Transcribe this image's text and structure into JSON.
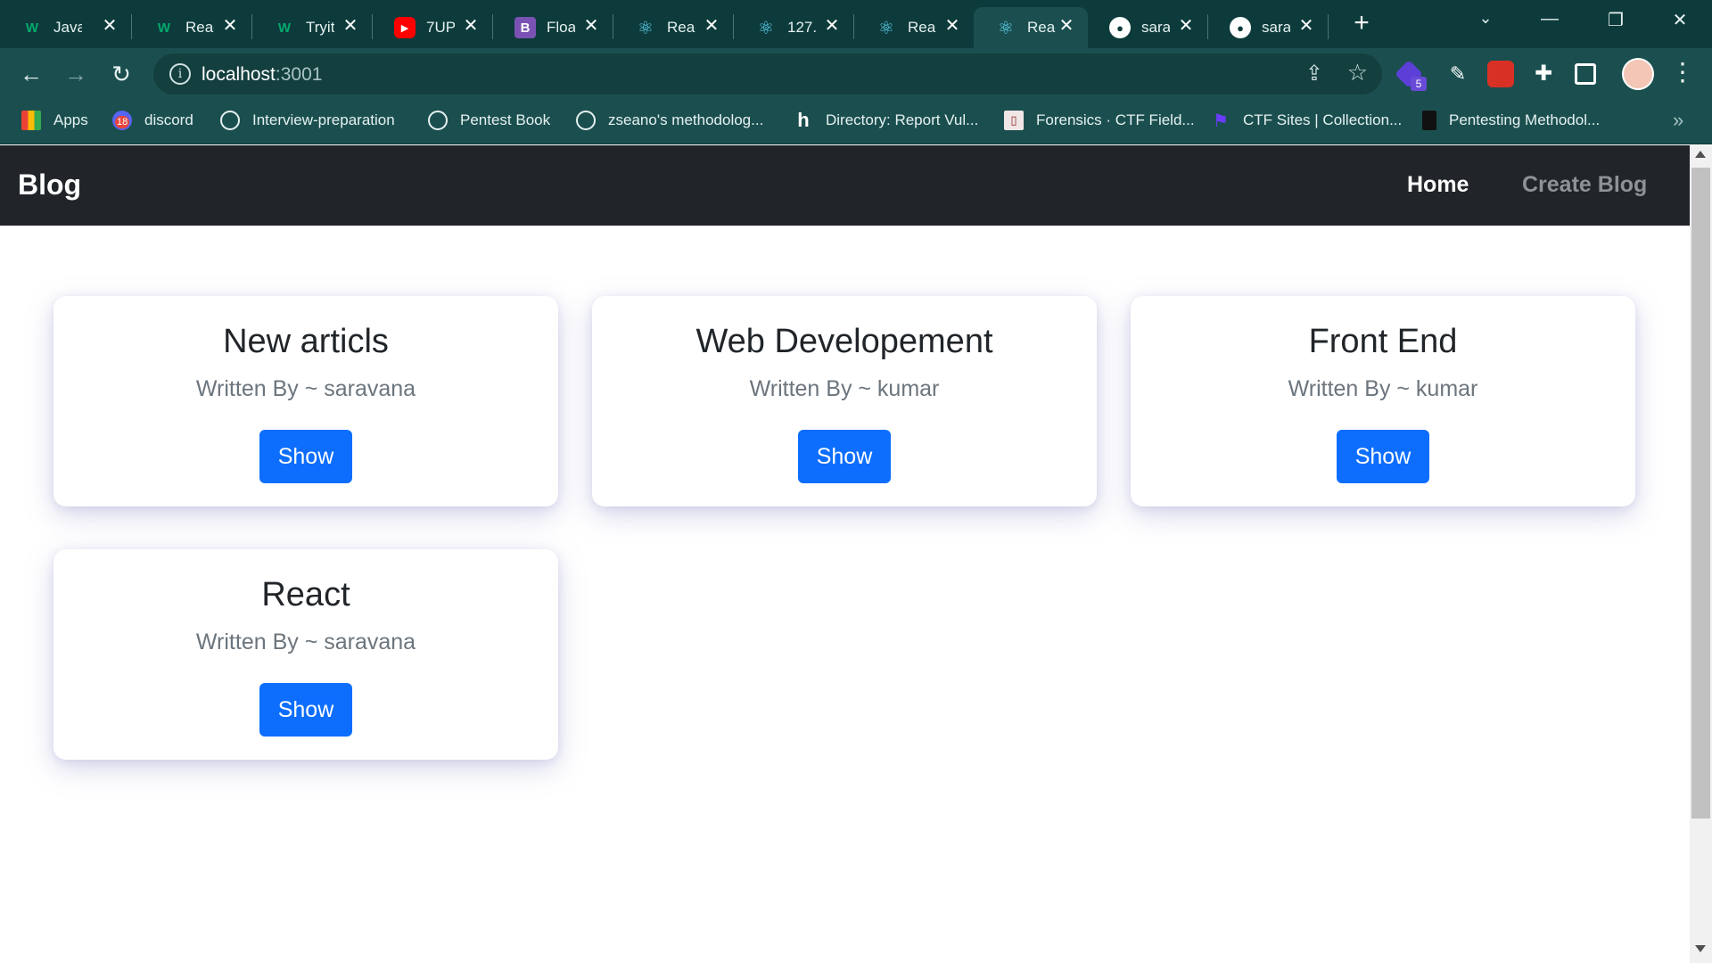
{
  "browser": {
    "tabs": [
      {
        "title": "Java",
        "icon": "w3schools-icon",
        "color": "#04aa6d"
      },
      {
        "title": "Reac",
        "icon": "w3schools-icon",
        "color": "#04aa6d"
      },
      {
        "title": "Tryit",
        "icon": "w3schools-icon",
        "color": "#04aa6d"
      },
      {
        "title": "7UP",
        "icon": "youtube-icon",
        "color": "#ff0000"
      },
      {
        "title": "Floa",
        "icon": "bootstrap-icon",
        "color": "#7952b3"
      },
      {
        "title": "Reac",
        "icon": "react-icon",
        "color": "#61dafb"
      },
      {
        "title": "127.",
        "icon": "react-icon",
        "color": "#61dafb"
      },
      {
        "title": "Reac",
        "icon": "react-icon",
        "color": "#61dafb"
      },
      {
        "title": "Reac",
        "icon": "react-icon",
        "color": "#61dafb",
        "active": true
      },
      {
        "title": "sara",
        "icon": "github-icon",
        "color": "#ffffff"
      },
      {
        "title": "sara",
        "icon": "github-icon",
        "color": "#ffffff"
      }
    ],
    "address": {
      "host": "localhost",
      "port": ":3001"
    },
    "bookmarks": [
      {
        "label": "Apps",
        "icon": "apps-grid-icon"
      },
      {
        "label": "discord",
        "icon": "discord-icon",
        "badge": "18"
      },
      {
        "label": "Interview-preparation",
        "icon": "globe-icon"
      },
      {
        "label": "Pentest Book",
        "icon": "globe-icon"
      },
      {
        "label": "zseano's methodolog...",
        "icon": "globe-icon"
      },
      {
        "label": "Directory: Report Vul...",
        "icon": "hackerone-icon"
      },
      {
        "label": "Forensics · CTF Field...",
        "icon": "book-icon"
      },
      {
        "label": "CTF Sites | Collection...",
        "icon": "flag-icon"
      },
      {
        "label": "Pentesting Methodol...",
        "icon": "page-icon"
      }
    ],
    "extension_badge": "5",
    "colors": {
      "chrome": "#1b4f4f",
      "tabstrip": "#0d3b3b"
    }
  },
  "app": {
    "brand": "Blog",
    "nav": {
      "home": "Home",
      "create": "Create Blog"
    },
    "cards": [
      {
        "title": "New articls",
        "author_line": "Written By ~ saravana",
        "button": "Show"
      },
      {
        "title": "Web Developement",
        "author_line": "Written By ~ kumar",
        "button": "Show"
      },
      {
        "title": "Front End",
        "author_line": "Written By ~ kumar",
        "button": "Show"
      },
      {
        "title": "React",
        "author_line": "Written By ~ saravana",
        "button": "Show"
      }
    ],
    "colors": {
      "navbar": "#212529",
      "primary_button": "#0d6efd",
      "muted_text": "#6c757d"
    }
  }
}
